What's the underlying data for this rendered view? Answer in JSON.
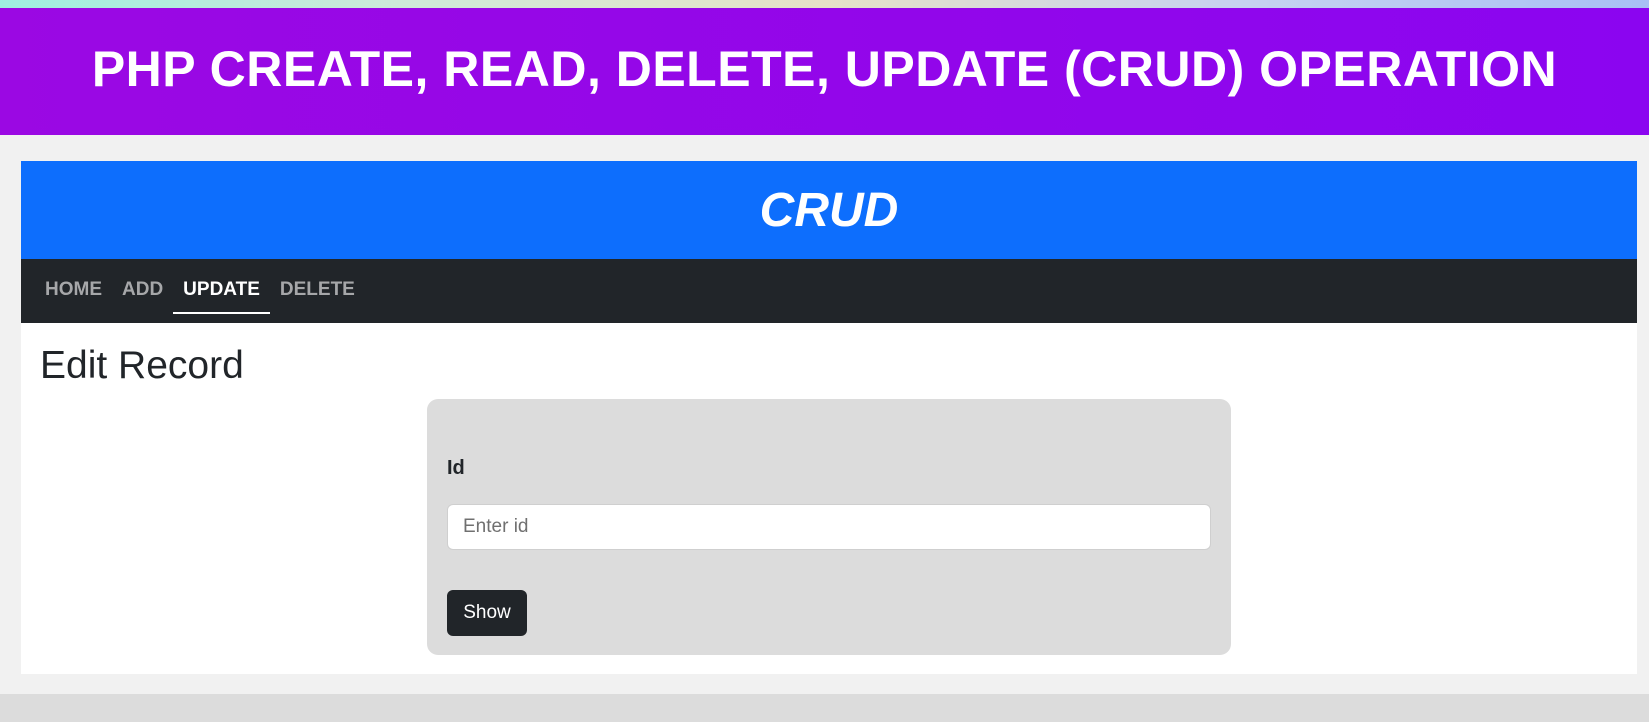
{
  "header": {
    "title": "PHP CREATE, READ, DELETE, UPDATE (CRUD) OPERATION"
  },
  "brand": {
    "title": "CRUD"
  },
  "nav": {
    "items": [
      {
        "label": "HOME",
        "active": false
      },
      {
        "label": "ADD",
        "active": false
      },
      {
        "label": "UPDATE",
        "active": true
      },
      {
        "label": "DELETE",
        "active": false
      }
    ]
  },
  "main": {
    "heading": "Edit Record",
    "form": {
      "id_label": "Id",
      "id_value": "",
      "id_placeholder": "Enter id",
      "submit_label": "Show"
    }
  },
  "colors": {
    "hero_background": "#9b08e3",
    "brand_background": "#0d6efd",
    "navbar_background": "#212529",
    "card_background": "#dcdcdc",
    "button_background": "#212529"
  }
}
